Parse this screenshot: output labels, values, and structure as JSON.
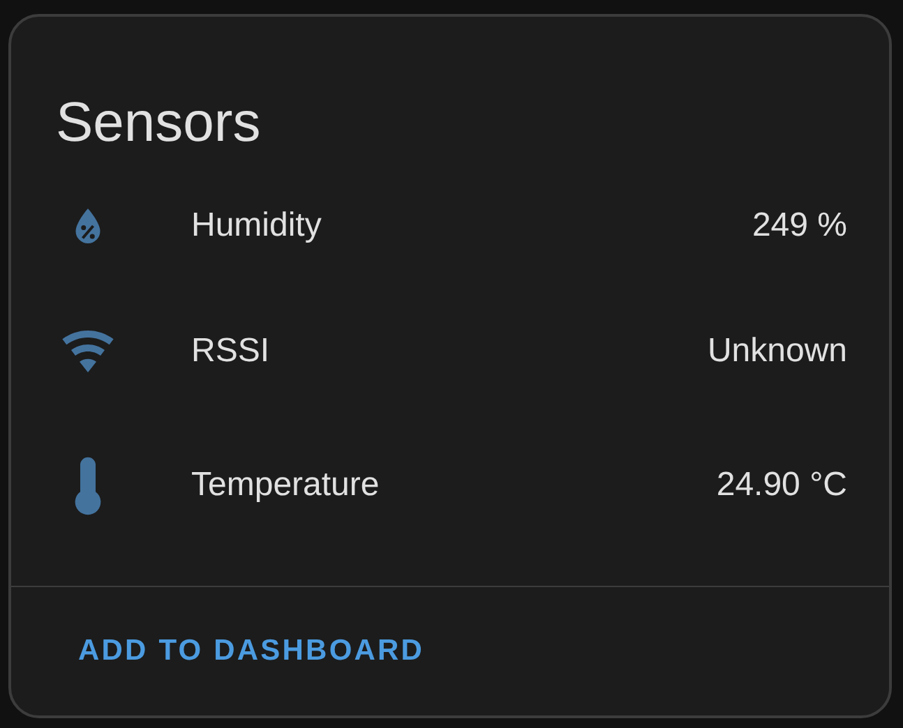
{
  "card": {
    "title": "Sensors",
    "sensors": [
      {
        "name": "Humidity",
        "value": "249 %"
      },
      {
        "name": "RSSI",
        "value": "Unknown"
      },
      {
        "name": "Temperature",
        "value": "24.90 °C"
      }
    ],
    "action": "ADD TO DASHBOARD"
  }
}
